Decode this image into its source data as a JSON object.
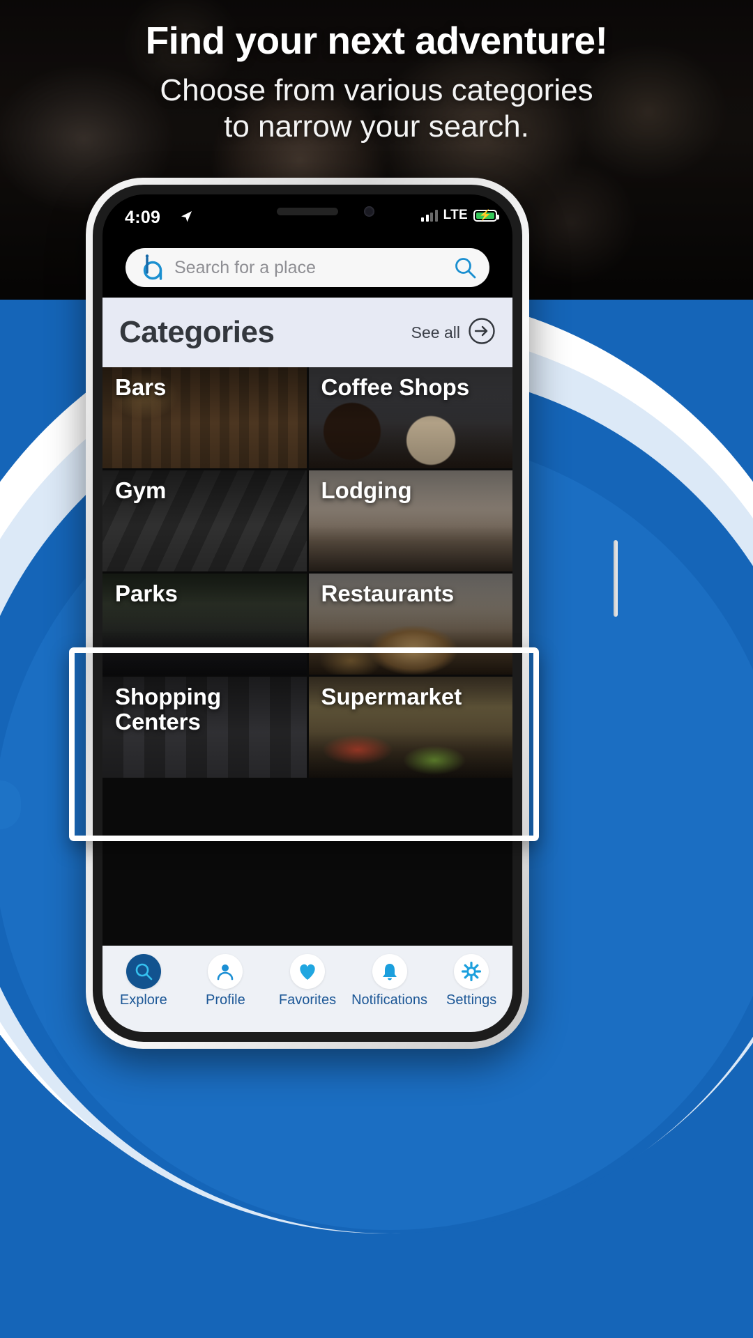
{
  "promo": {
    "headline": "Find your next adventure!",
    "subheadline_line1": "Choose from various categories",
    "subheadline_line2": "to narrow your search."
  },
  "colors": {
    "brand_blue": "#1565b8",
    "accent_blue": "#1c5796",
    "active_tab": "#12538f",
    "header_bg": "#e7eaf4",
    "battery_green": "#34c759",
    "highlight_border": "#ffffff"
  },
  "phone": {
    "status_bar": {
      "time": "4:09",
      "location_icon": "location-arrow-icon",
      "signal_icon": "signal-bars-icon",
      "network": "LTE",
      "battery_icon": "battery-charging-icon"
    },
    "search": {
      "logo_icon": "app-logo-icon",
      "placeholder": "Search for a place",
      "value": "",
      "search_icon": "search-icon"
    },
    "categories_header": {
      "title": "Categories",
      "see_all_label": "See all",
      "see_all_icon": "arrow-right-circle-icon"
    },
    "categories": [
      {
        "label": "Bars",
        "tile_class": "t-bars"
      },
      {
        "label": "Coffee Shops",
        "tile_class": "t-coffee"
      },
      {
        "label": "Gym",
        "tile_class": "t-gym"
      },
      {
        "label": "Lodging",
        "tile_class": "t-lodging"
      },
      {
        "label": "Parks",
        "tile_class": "t-parks"
      },
      {
        "label": "Restaurants",
        "tile_class": "t-restaurants"
      },
      {
        "label": "Shopping Centers",
        "tile_class": "t-shopping"
      },
      {
        "label": "Supermarket",
        "tile_class": "t-supermarket"
      }
    ],
    "tabs": [
      {
        "label": "Explore",
        "icon": "search-icon",
        "active": true
      },
      {
        "label": "Profile",
        "icon": "person-icon",
        "active": false
      },
      {
        "label": "Favorites",
        "icon": "heart-icon",
        "active": false
      },
      {
        "label": "Notifications",
        "icon": "bell-icon",
        "active": false
      },
      {
        "label": "Settings",
        "icon": "gear-icon",
        "active": false
      }
    ]
  }
}
